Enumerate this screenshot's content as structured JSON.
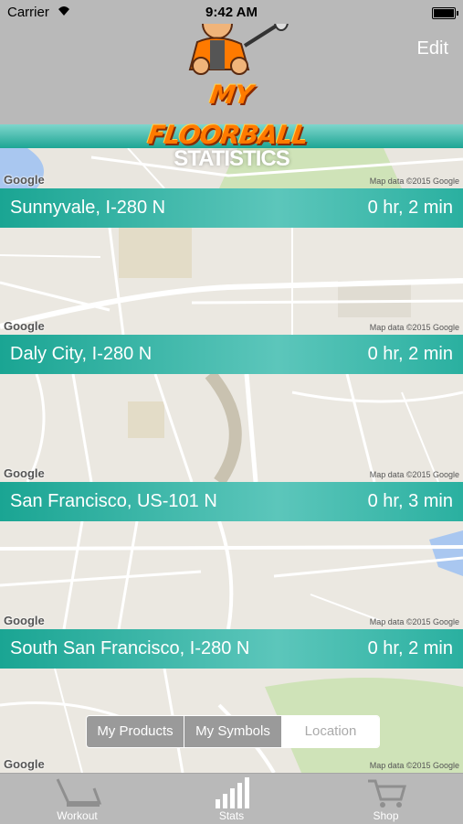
{
  "status_bar": {
    "carrier": "Carrier",
    "time": "9:42 AM"
  },
  "nav": {
    "edit_label": "Edit",
    "logo_text": "MY FLOORBALL"
  },
  "page_title": "STATISTICS",
  "map_labels": {
    "google": "Google",
    "map_data": "Map data ©2015 Google"
  },
  "trips": [
    {
      "city": "Sunnyvale, I-280 N",
      "duration": "0 hr, 2 min"
    },
    {
      "city": "Daly City, I-280 N",
      "duration": "0 hr, 2 min"
    },
    {
      "city": "San Francisco, US-101 N",
      "duration": "0 hr, 3 min"
    },
    {
      "city": "South San Francisco, I-280 N",
      "duration": "0 hr, 2 min"
    }
  ],
  "segments": [
    {
      "label": "My Products",
      "selected": false
    },
    {
      "label": "My Symbols",
      "selected": false
    },
    {
      "label": "Location",
      "selected": true
    }
  ],
  "tabs": [
    {
      "label": "Workout",
      "icon": "workout-icon"
    },
    {
      "label": "Stats",
      "icon": "stats-icon"
    },
    {
      "label": "Shop",
      "icon": "shop-cart-icon"
    }
  ],
  "colors": {
    "teal": "#1aa593",
    "chrome": "#b9b9b9",
    "logo_orange": "#ff7a00"
  }
}
